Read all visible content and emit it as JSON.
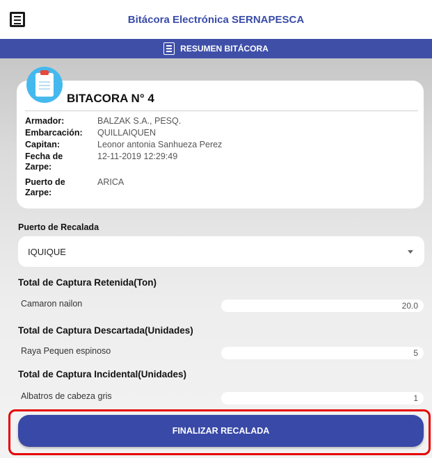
{
  "header": {
    "title": "Bitácora Electrónica SERNAPESCA",
    "menu_icon": "menu-icon"
  },
  "section_bar": {
    "label": "RESUMEN BITÁCORA",
    "icon": "list-icon"
  },
  "card": {
    "icon": "clipboard-icon",
    "title": "BITACORA N° 4",
    "fields": [
      {
        "label": "Armador:",
        "value": "BALZAK S.A., PESQ."
      },
      {
        "label": "Embarcación:",
        "value": "QUILLAIQUEN"
      },
      {
        "label": "Capitan:",
        "value": "Leonor antonia Sanhueza Perez"
      },
      {
        "label": "Fecha de Zarpe:",
        "value": "12-11-2019 12:29:49"
      },
      {
        "label": "Puerto de Zarpe:",
        "value": "ARICA"
      }
    ]
  },
  "recalada": {
    "label": "Puerto de Recalada",
    "selected": "IQUIQUE"
  },
  "captures": [
    {
      "title": "Total de Captura Retenida(Ton)",
      "species": "Camaron nailon",
      "value": "20.0"
    },
    {
      "title": "Total de Captura Descartada(Unidades)",
      "species": "Raya Pequen espinoso",
      "value": "5"
    },
    {
      "title": "Total de Captura Incidental(Unidades)",
      "species": "Albatros de cabeza gris",
      "value": "1"
    }
  ],
  "action": {
    "finish_label": "FINALIZAR RECALADA"
  },
  "colors": {
    "primary": "#3f4fa8",
    "title_text": "#3a4ca8",
    "highlight": "#e60000",
    "icon_circle": "#45b9ee"
  }
}
